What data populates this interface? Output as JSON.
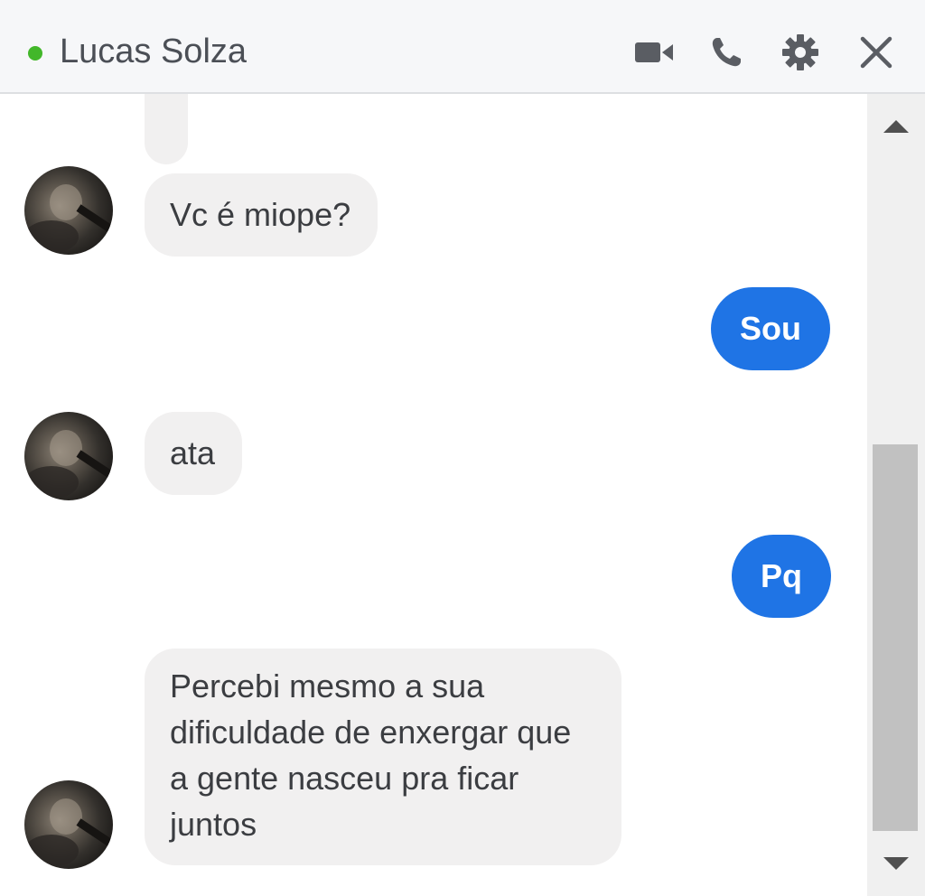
{
  "header": {
    "contact_name": "Lucas Solza",
    "presence_color": "#42b72a",
    "icons": [
      "video-camera-icon",
      "phone-icon",
      "gear-icon",
      "close-icon"
    ]
  },
  "messages": [
    {
      "sender": "contact",
      "text": "Vc é miope?"
    },
    {
      "sender": "me",
      "text": "Sou"
    },
    {
      "sender": "contact",
      "text": "ata"
    },
    {
      "sender": "me",
      "text": "Pq"
    },
    {
      "sender": "contact",
      "text": "Percebi mesmo a sua dificuldade de enxergar que a gente nasceu pra ficar juntos"
    }
  ],
  "colors": {
    "outgoing_bubble": "#1f74e5",
    "incoming_bubble": "#f1f0f0",
    "header_bg": "#f6f7f9"
  }
}
